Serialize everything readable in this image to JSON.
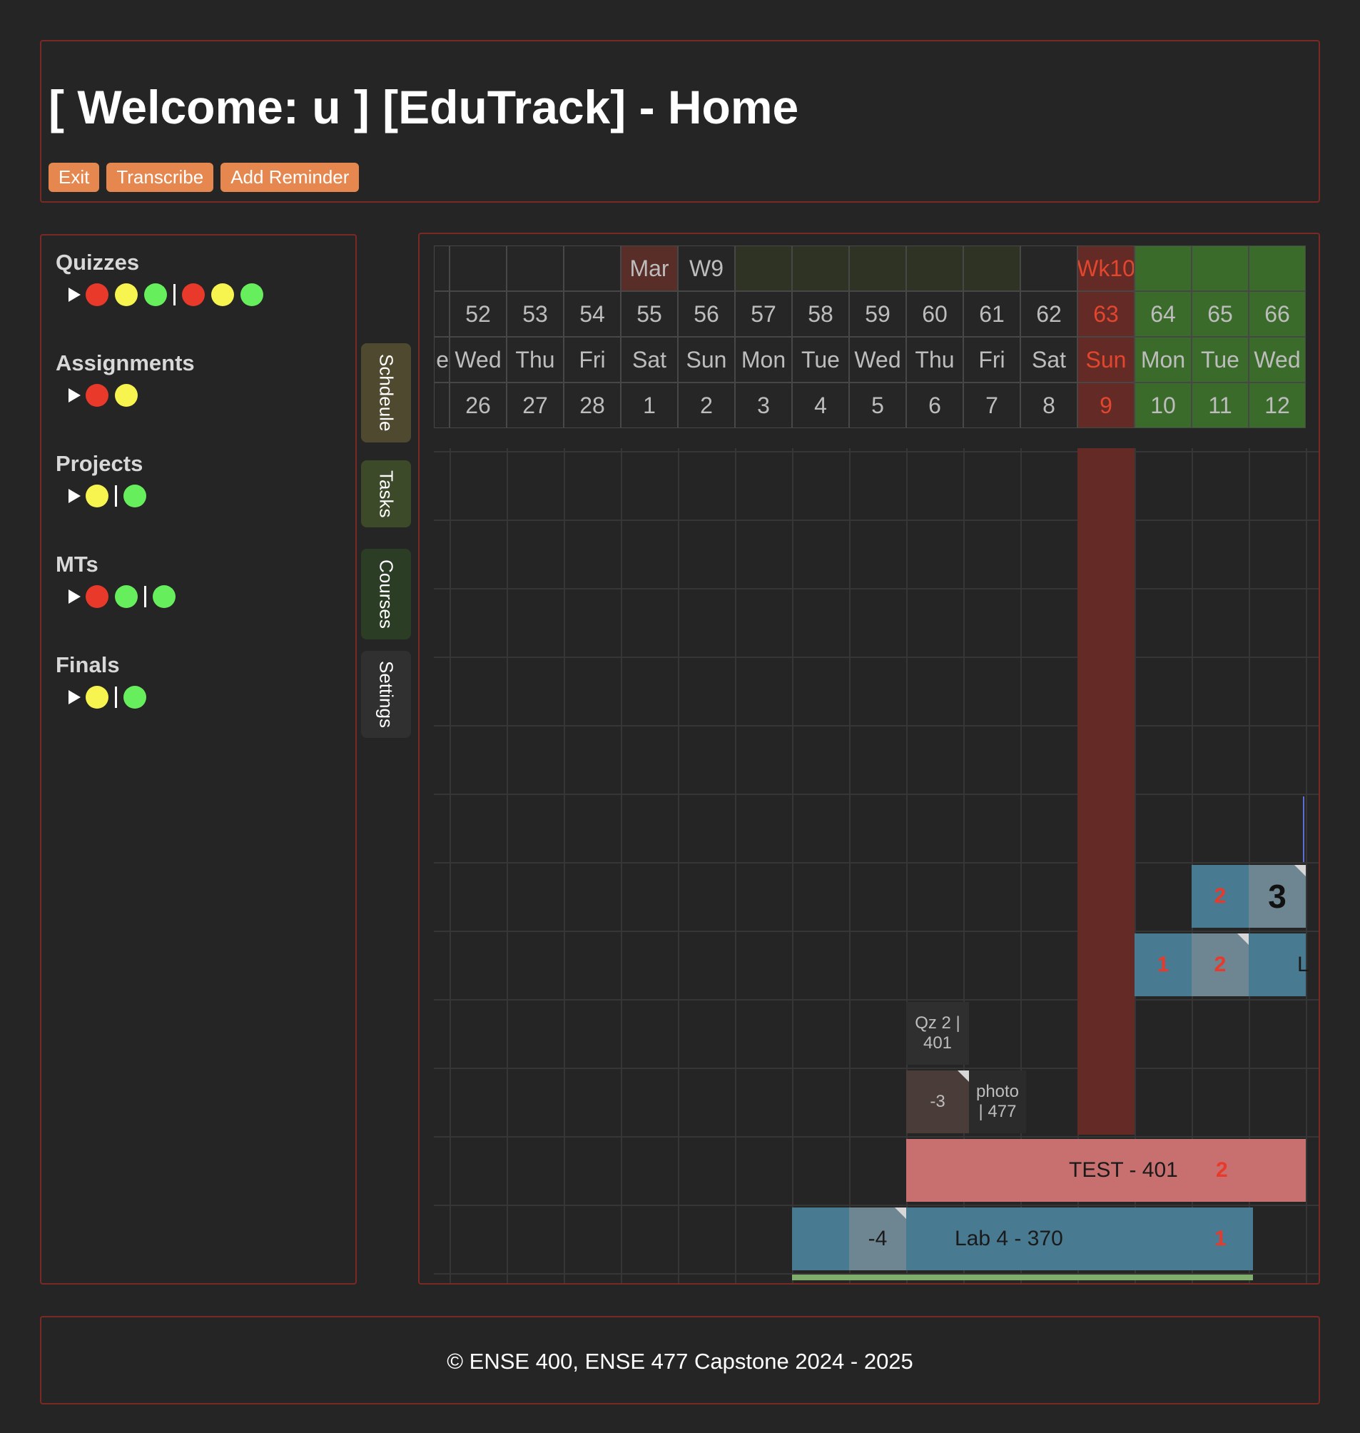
{
  "header": {
    "title": "[ Welcome: u ] [EduTrack] - Home",
    "buttons": {
      "exit": "Exit",
      "transcribe": "Transcribe",
      "add_reminder": "Add Reminder"
    }
  },
  "sidebar": {
    "categories": [
      {
        "title": "Quizzes",
        "marks": [
          "red",
          "yellow",
          "green",
          "|",
          "red",
          "yellow",
          "green"
        ]
      },
      {
        "title": "Assignments",
        "marks": [
          "red",
          "yellow"
        ]
      },
      {
        "title": "Projects",
        "marks": [
          "yellow",
          "|",
          "green"
        ]
      },
      {
        "title": "MTs",
        "marks": [
          "red",
          "green",
          "|",
          "green"
        ]
      },
      {
        "title": "Finals",
        "marks": [
          "yellow",
          "|",
          "green"
        ]
      }
    ]
  },
  "tabs": {
    "schedule": "Schdeule",
    "tasks": "Tasks",
    "courses": "Courses",
    "settings": "Settings"
  },
  "calendar": {
    "partial_day": "e",
    "days": [
      {
        "num": "52",
        "dow": "Wed",
        "date": "26"
      },
      {
        "num": "53",
        "dow": "Thu",
        "date": "27"
      },
      {
        "num": "54",
        "dow": "Fri",
        "date": "28"
      },
      {
        "num": "55",
        "dow": "Sat",
        "date": "1",
        "top": "Mar"
      },
      {
        "num": "56",
        "dow": "Sun",
        "date": "2",
        "top": "W9"
      },
      {
        "num": "57",
        "dow": "Mon",
        "date": "3"
      },
      {
        "num": "58",
        "dow": "Tue",
        "date": "4"
      },
      {
        "num": "59",
        "dow": "Wed",
        "date": "5"
      },
      {
        "num": "60",
        "dow": "Thu",
        "date": "6"
      },
      {
        "num": "61",
        "dow": "Fri",
        "date": "7"
      },
      {
        "num": "62",
        "dow": "Sat",
        "date": "8"
      },
      {
        "num": "63",
        "dow": "Sun",
        "date": "9",
        "top": "Wk10"
      },
      {
        "num": "64",
        "dow": "Mon",
        "date": "10"
      },
      {
        "num": "65",
        "dow": "Tue",
        "date": "11"
      },
      {
        "num": "66",
        "dow": "Wed",
        "date": "12"
      }
    ],
    "events": {
      "top_nums": {
        "a": "2",
        "b": "3"
      },
      "row2": {
        "a": "1",
        "b": "2",
        "c": "L"
      },
      "quiz": "Qz 2 | 401",
      "photo_offset": "-3",
      "photo": "photo | 477",
      "test": {
        "label": "TEST - 401",
        "num": "2"
      },
      "lab": {
        "offset": "-4",
        "label": "Lab 4 - 370",
        "num": "1"
      }
    },
    "colors": {
      "today": "#e3452d",
      "accent_green": "#3b6b2b",
      "blue_bar": "#487a92",
      "red_bar": "#c87070"
    }
  },
  "footer": {
    "text": "© ENSE 400, ENSE 477 Capstone 2024 - 2025"
  }
}
